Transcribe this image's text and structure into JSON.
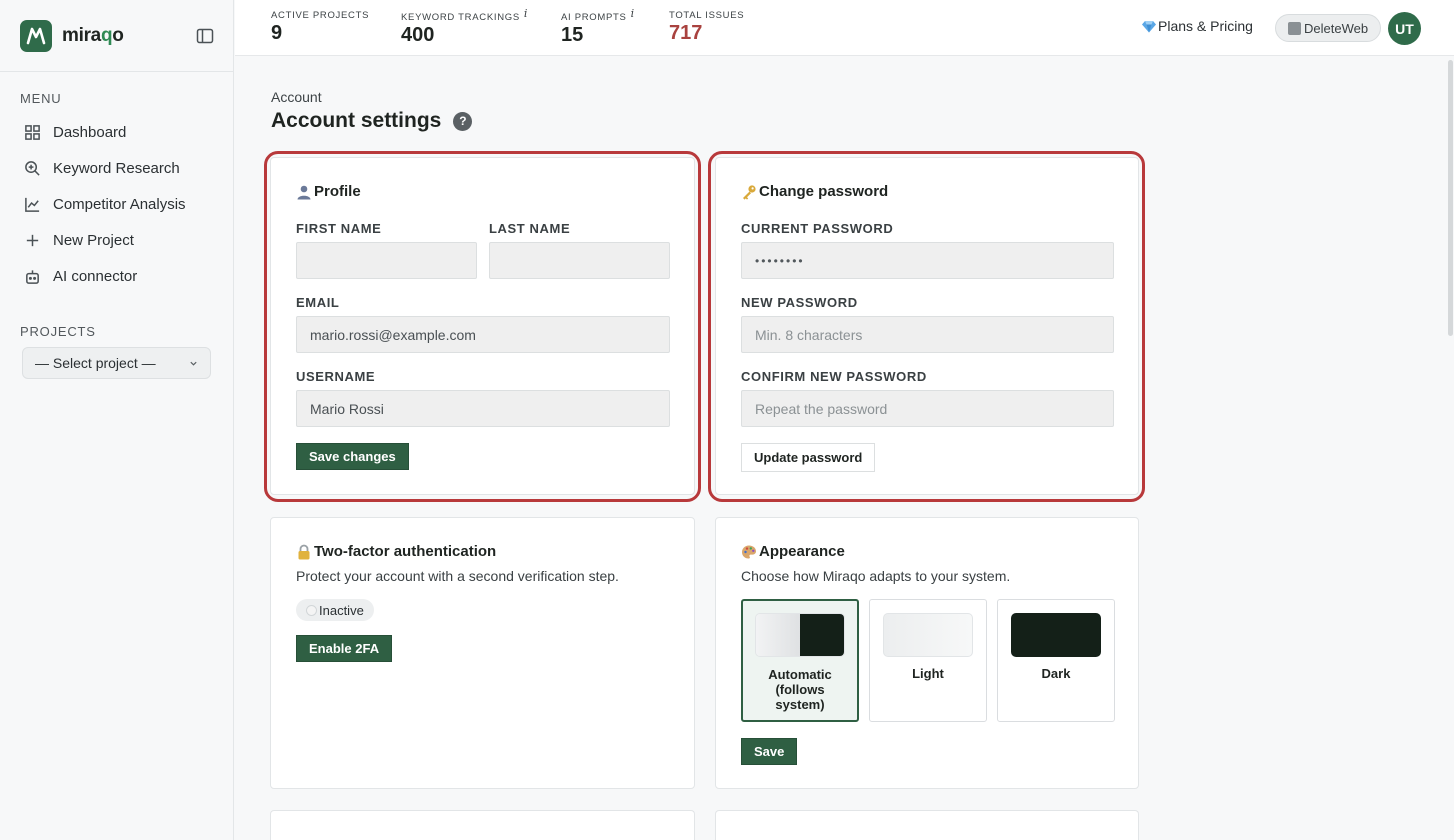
{
  "brand": {
    "name_prefix": "mira",
    "name_accent": "q",
    "name_suffix": "o"
  },
  "sidebar": {
    "menu_label": "MENU",
    "items": [
      {
        "label": "Dashboard",
        "icon": "grid-icon"
      },
      {
        "label": "Keyword Research",
        "icon": "magnify-plus-icon"
      },
      {
        "label": "Competitor Analysis",
        "icon": "line-chart-icon"
      },
      {
        "label": "New Project",
        "icon": "plus-icon"
      },
      {
        "label": "AI connector",
        "icon": "robot-icon"
      }
    ],
    "projects_label": "PROJECTS",
    "project_select": "— Select project —"
  },
  "topbar": {
    "stats": [
      {
        "label": "ACTIVE PROJECTS",
        "value": "9",
        "info": ""
      },
      {
        "label": "KEYWORD TRACKINGS",
        "value": "400",
        "info": "i"
      },
      {
        "label": "AI PROMPTS",
        "value": "15",
        "info": "i"
      },
      {
        "label": "TOTAL ISSUES",
        "value": "717",
        "info": ""
      }
    ],
    "plans_label": "Plans & Pricing",
    "workspace": "DeleteWeb",
    "avatar_initials": "UT"
  },
  "page": {
    "breadcrumb": "Account",
    "title": "Account settings",
    "help": "?"
  },
  "profile": {
    "title": "Profile",
    "first_name_label": "FIRST NAME",
    "first_name_value": "",
    "last_name_label": "LAST NAME",
    "last_name_value": "",
    "email_label": "EMAIL",
    "email_value": "mario.rossi@example.com",
    "username_label": "USERNAME",
    "username_value": "Mario Rossi",
    "save_label": "Save changes"
  },
  "password": {
    "title": "Change password",
    "current_label": "CURRENT PASSWORD",
    "current_value": "••••••••",
    "new_label": "NEW PASSWORD",
    "new_placeholder": "Min. 8 characters",
    "confirm_label": "CONFIRM NEW PASSWORD",
    "confirm_placeholder": "Repeat the password",
    "update_label": "Update password"
  },
  "twofa": {
    "title": "Two-factor authentication",
    "description": "Protect your account with a second verification step.",
    "status": "Inactive",
    "enable_label": "Enable 2FA"
  },
  "appearance": {
    "title": "Appearance",
    "description": "Choose how Miraqo adapts to your system.",
    "options": [
      {
        "label": "Automatic (follows system)",
        "selected": true
      },
      {
        "label": "Light",
        "selected": false
      },
      {
        "label": "Dark",
        "selected": false
      }
    ],
    "save_label": "Save"
  },
  "colors": {
    "accent": "#2f5f43",
    "brand": "#2f6b4a",
    "issues": "#a9423f",
    "highlight": "#b8393b"
  }
}
